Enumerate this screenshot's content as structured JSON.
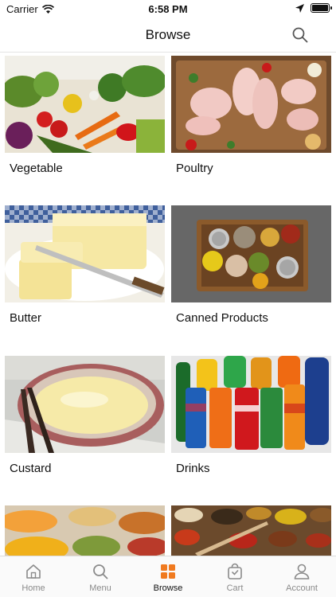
{
  "status_bar": {
    "carrier": "Carrier",
    "time": "6:58 PM"
  },
  "nav": {
    "title": "Browse"
  },
  "categories": [
    {
      "label": "Vegetable"
    },
    {
      "label": "Poultry"
    },
    {
      "label": "Butter"
    },
    {
      "label": "Canned Products"
    },
    {
      "label": "Custard"
    },
    {
      "label": "Drinks"
    },
    {
      "label": ""
    },
    {
      "label": ""
    }
  ],
  "tabs": [
    {
      "label": "Home",
      "icon": "home-icon"
    },
    {
      "label": "Menu",
      "icon": "search-icon"
    },
    {
      "label": "Browse",
      "icon": "grid-icon",
      "active": true
    },
    {
      "label": "Cart",
      "icon": "bag-icon"
    },
    {
      "label": "Account",
      "icon": "person-icon"
    }
  ],
  "colors": {
    "accent": "#f07a1f",
    "inactive": "#8a8a8a"
  }
}
